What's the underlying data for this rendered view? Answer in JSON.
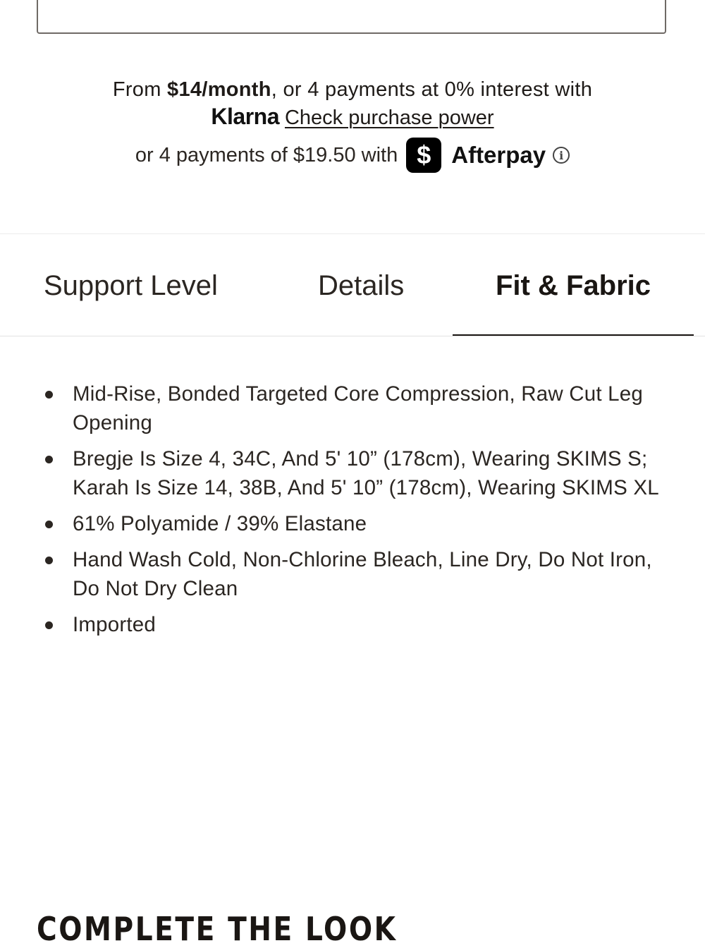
{
  "payment": {
    "klarna_prefix": "From ",
    "klarna_amount": "$14/month",
    "klarna_suffix": ", or 4 payments at 0% interest with",
    "klarna_logo": "Klarna",
    "klarna_link": "Check purchase power",
    "afterpay_text": "or 4 payments of $19.50 with",
    "cashapp_glyph": "$",
    "afterpay_name": "Afterpay",
    "info_glyph": "i"
  },
  "tabs": [
    {
      "label": "Support Level",
      "active": false
    },
    {
      "label": "Details",
      "active": false
    },
    {
      "label": "Fit & Fabric",
      "active": true
    }
  ],
  "details": [
    "Mid-Rise, Bonded Targeted Core Compression, Raw Cut Leg Opening",
    "Bregje Is Size 4, 34C, And 5' 10” (178cm), Wearing SKIMS S; Karah Is Size 14, 38B, And 5' 10” (178cm), Wearing SKIMS XL",
    "61% Polyamide / 39% Elastane",
    "Hand Wash Cold, Non-Chlorine Bleach, Line Dry, Do Not Iron, Do Not Dry Clean",
    "Imported"
  ],
  "complete_look": {
    "heading": "COMPLETE THE LOOK"
  },
  "colors": {
    "text": "#2b2622",
    "active_tab": "#1a1613",
    "cashapp_bg": "#000000"
  }
}
